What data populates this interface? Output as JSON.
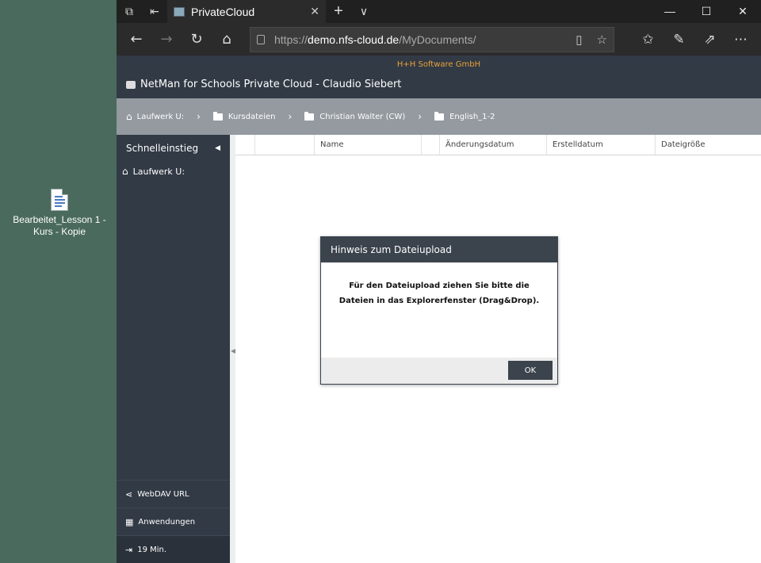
{
  "desktop": {
    "icon_label": "Bearbeitet_Lesson 1 - Kurs - Kopie"
  },
  "browser": {
    "tab_title": "PrivateCloud",
    "new_tab": "+",
    "tab_list": "∨",
    "url_prefix": "https://",
    "url_host": "demo.nfs-cloud.de",
    "url_path": "/MyDocuments/",
    "window_controls": {
      "minimize": "—",
      "maximize": "☐",
      "close": "✕"
    }
  },
  "app": {
    "company": "H+H Software GmbH",
    "title": "NetMan for Schools Private Cloud - Claudio Siebert",
    "breadcrumb": [
      {
        "label": "Laufwerk U:",
        "icon": "home-icon"
      },
      {
        "label": "Kursdateien",
        "icon": "folder-icon"
      },
      {
        "label": "Christian Walter (CW)",
        "icon": "folder-icon"
      },
      {
        "label": "English_1-2",
        "icon": "folder-icon"
      }
    ],
    "sidebar": {
      "heading": "Schnelleinstieg",
      "items": [
        {
          "label": "Laufwerk U:",
          "icon": "home-icon"
        }
      ],
      "bottom": [
        {
          "label": "WebDAV URL",
          "icon": "share-icon"
        },
        {
          "label": "Anwendungen",
          "icon": "apps-icon"
        },
        {
          "label": "19 Min.",
          "icon": "logout-icon"
        }
      ]
    },
    "columns": [
      "",
      "",
      "Name",
      "",
      "Änderungsdatum",
      "Erstelldatum",
      "Dateigröße"
    ]
  },
  "dialog": {
    "title": "Hinweis zum Dateiupload",
    "message": "Für den Dateiupload ziehen Sie bitte die Dateien in das Explorerfenster (Drag&Drop).",
    "ok_label": "OK"
  }
}
